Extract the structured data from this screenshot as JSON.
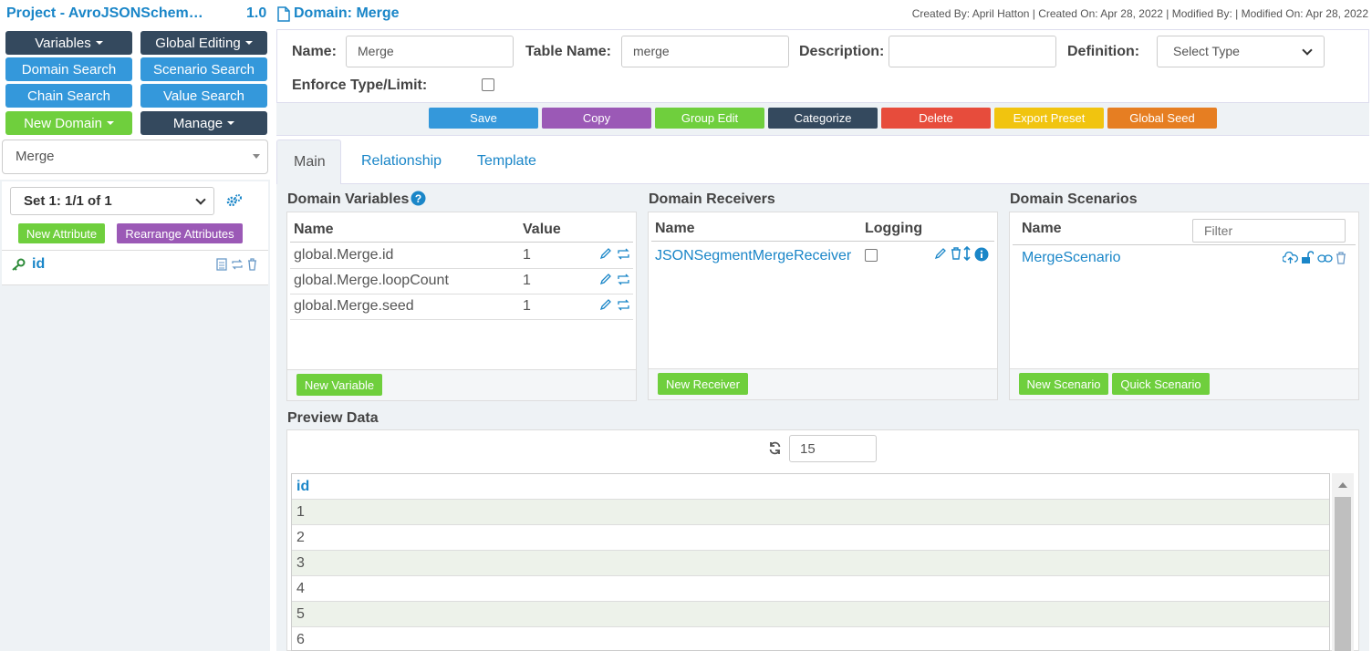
{
  "header": {
    "project_title": "Project - AvroJSONSchem…",
    "version": "1.0",
    "domain_title": "Domain: Merge",
    "meta": "Created By: April Hatton | Created On: Apr 28, 2022 | Modified By: | Modified On: Apr 28, 2022"
  },
  "sidebar": {
    "variables": "Variables",
    "global_editing": "Global Editing",
    "domain_search": "Domain Search",
    "scenario_search": "Scenario Search",
    "chain_search": "Chain Search",
    "value_search": "Value Search",
    "new_domain": "New Domain",
    "manage": "Manage",
    "selected_domain": "Merge",
    "set_select": "Set 1: 1/1 of 1",
    "new_attribute": "New Attribute",
    "rearrange_attributes": "Rearrange Attributes",
    "attribute_name": "id"
  },
  "form": {
    "name_label": "Name:",
    "name_value": "Merge",
    "table_name_label": "Table Name:",
    "table_name_value": "merge",
    "description_label": "Description:",
    "description_value": "",
    "definition_label": "Definition:",
    "definition_value": "Select Type",
    "enforce_label": "Enforce Type/Limit:"
  },
  "actions": {
    "save": "Save",
    "copy": "Copy",
    "group_edit": "Group Edit",
    "categorize": "Categorize",
    "delete": "Delete",
    "export_preset": "Export Preset",
    "global_seed": "Global Seed"
  },
  "colors": {
    "save": "#3498db",
    "copy": "#9b59b6",
    "group_edit": "#6fcf3d",
    "categorize": "#34495e",
    "delete": "#e74c3c",
    "export_preset": "#f1c40f",
    "global_seed": "#e67e22"
  },
  "tabs": [
    "Main",
    "Relationship",
    "Template"
  ],
  "variables": {
    "title": "Domain Variables",
    "col_name": "Name",
    "col_value": "Value",
    "rows": [
      {
        "name": "global.Merge.id",
        "value": "1"
      },
      {
        "name": "global.Merge.loopCount",
        "value": "1"
      },
      {
        "name": "global.Merge.seed",
        "value": "1"
      }
    ],
    "new_button": "New Variable"
  },
  "receivers": {
    "title": "Domain Receivers",
    "col_name": "Name",
    "col_logging": "Logging",
    "rows": [
      {
        "name": "JSONSegmentMergeReceiver"
      }
    ],
    "new_button": "New Receiver"
  },
  "scenarios": {
    "title": "Domain Scenarios",
    "col_name": "Name",
    "filter_placeholder": "Filter",
    "rows": [
      {
        "name": "MergeScenario"
      }
    ],
    "new_button": "New Scenario",
    "quick_button": "Quick Scenario"
  },
  "preview": {
    "title": "Preview Data",
    "count": "15",
    "column": "id",
    "rows": [
      "1",
      "2",
      "3",
      "4",
      "5",
      "6"
    ]
  }
}
